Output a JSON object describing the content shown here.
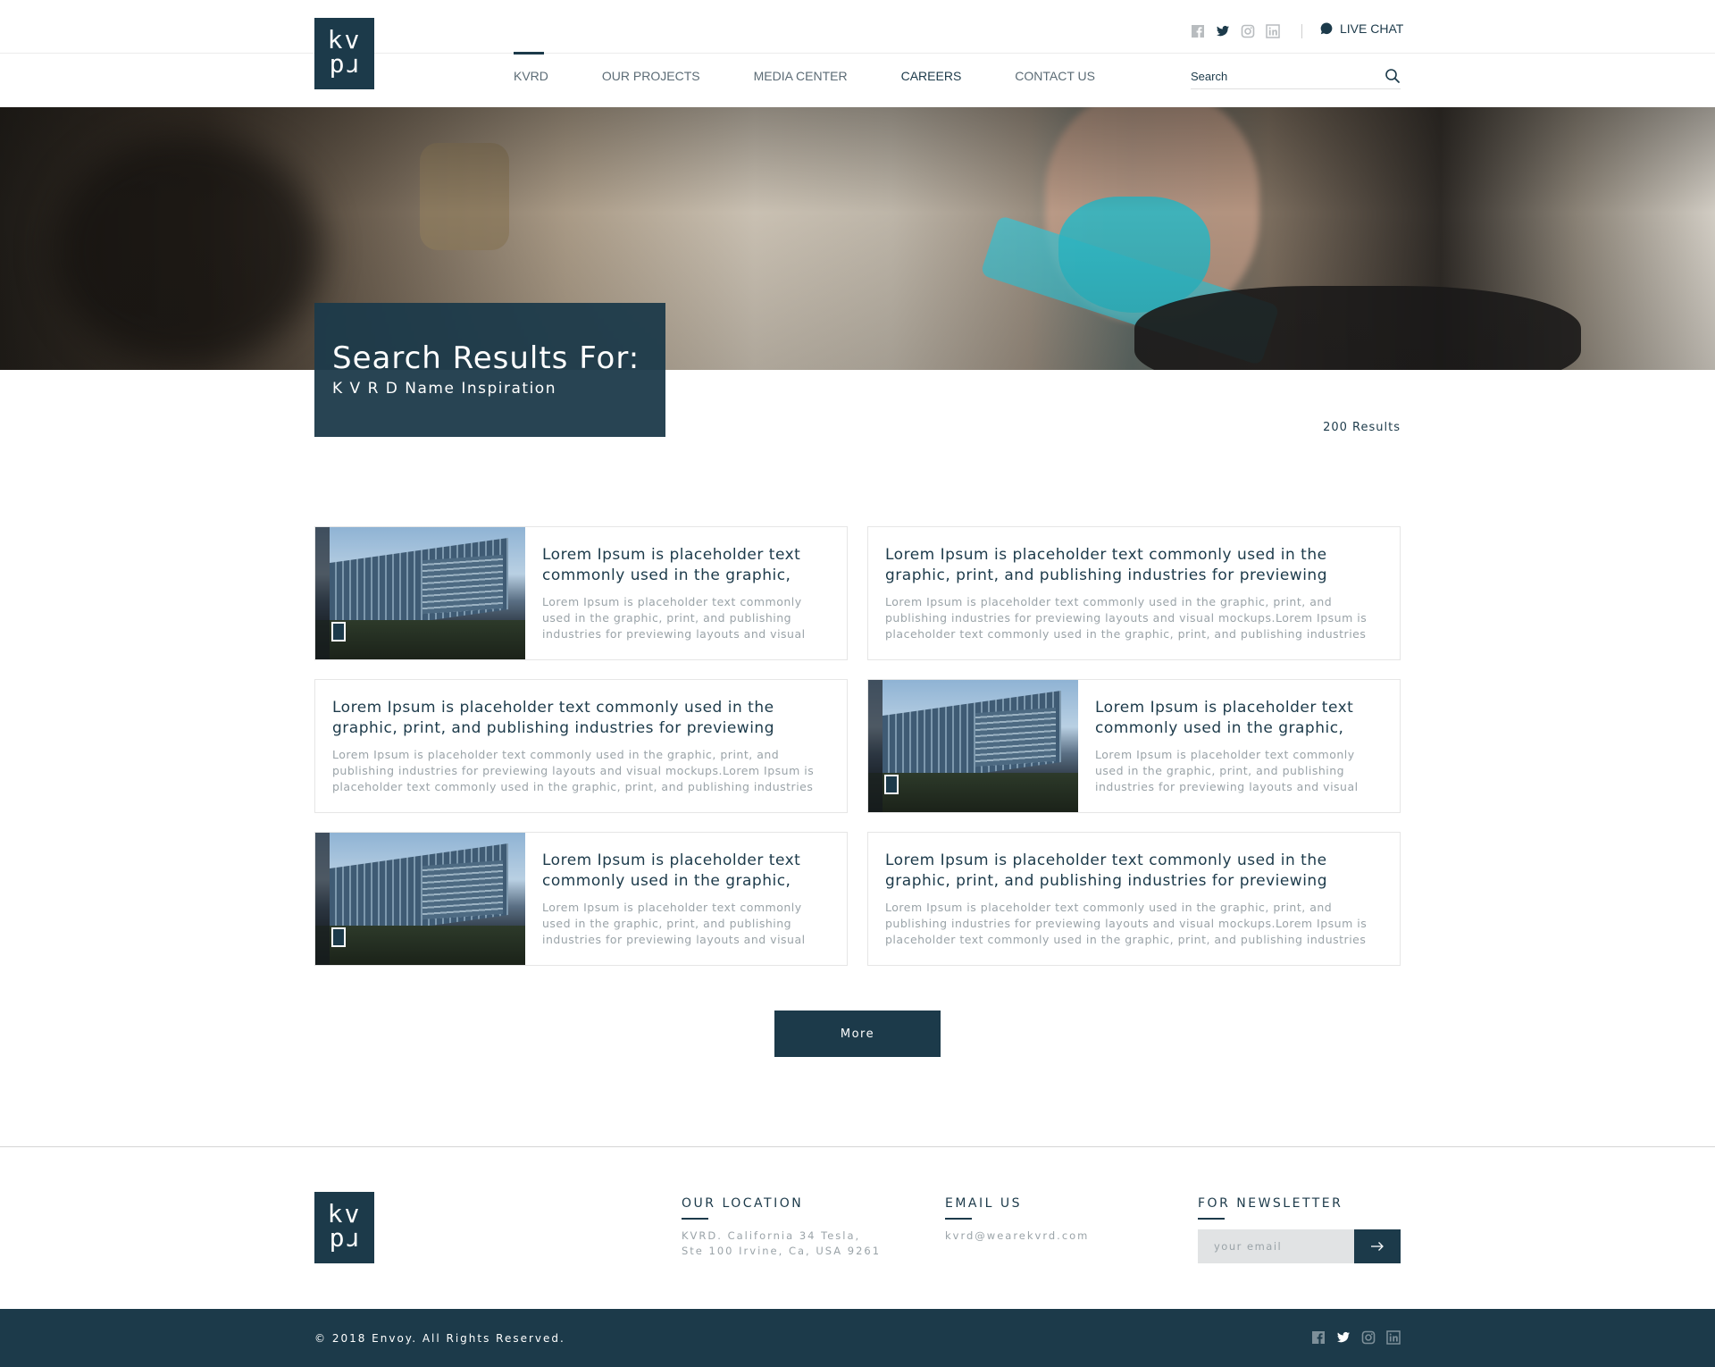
{
  "brand": {
    "logo_line1": "kv",
    "logo_line2": "rd",
    "primary_color": "#1c3a4a"
  },
  "header": {
    "social_icons": [
      "facebook-icon",
      "twitter-icon",
      "instagram-icon",
      "linkedin-icon"
    ],
    "live_chat_label": "LIVE CHAT",
    "nav": [
      {
        "label": "KVRD",
        "active": true
      },
      {
        "label": "OUR PROJECTS",
        "active": false
      },
      {
        "label": "MEDIA CENTER",
        "active": false
      },
      {
        "label": "CAREERS",
        "active": false
      },
      {
        "label": "CONTACT US",
        "active": false
      }
    ],
    "search_placeholder": "Search"
  },
  "hero": {
    "title": "Search Results For:",
    "subtitle": "K V R D Name Inspiration",
    "results_count": "200 Results"
  },
  "results": [
    {
      "has_image": true,
      "title": "Lorem Ipsum is placeholder text commonly used in the graphic,",
      "description": "Lorem Ipsum is placeholder text commonly used in the graphic, print, and publishing industries for previewing layouts and visual"
    },
    {
      "has_image": false,
      "title": "Lorem Ipsum is placeholder text commonly used in the graphic, print, and publishing industries for previewing layouts",
      "description": "Lorem Ipsum is placeholder text commonly used in the graphic, print, and publishing industries for previewing layouts and visual mockups.Lorem Ipsum is placeholder text commonly used in the graphic, print, and publishing industries"
    },
    {
      "has_image": false,
      "title": "Lorem Ipsum is placeholder text commonly used in the graphic, print, and publishing industries for previewing layouts",
      "description": "Lorem Ipsum is placeholder text commonly used in the graphic, print, and publishing industries for previewing layouts and visual mockups.Lorem Ipsum is placeholder text commonly used in the graphic, print, and publishing industries"
    },
    {
      "has_image": true,
      "title": "Lorem Ipsum is placeholder text commonly used in the graphic,",
      "description": "Lorem Ipsum is placeholder text commonly used in the graphic, print, and publishing industries for previewing layouts and visual"
    },
    {
      "has_image": true,
      "title": "Lorem Ipsum is placeholder text commonly used in the graphic,",
      "description": "Lorem Ipsum is placeholder text commonly used in the graphic, print, and publishing industries for previewing layouts and visual"
    },
    {
      "has_image": false,
      "title": "Lorem Ipsum is placeholder text commonly used in the graphic, print, and publishing industries for previewing layouts",
      "description": "Lorem Ipsum is placeholder text commonly used in the graphic, print, and publishing industries for previewing layouts and visual mockups.Lorem Ipsum is placeholder text commonly used in the graphic, print, and publishing industries"
    }
  ],
  "more_label": "More",
  "footer": {
    "location_heading": "OUR LOCATION",
    "location_line1": "KVRD. California 34 Tesla,",
    "location_line2": "Ste 100 Irvine, Ca, USA 9261",
    "email_heading": "EMAIL US",
    "email": "kvrd@wearekvrd.com",
    "newsletter_heading": "FOR NEWSLETTER",
    "newsletter_placeholder": "your email",
    "copyright": "© 2018 Envoy. All Rights Reserved."
  }
}
